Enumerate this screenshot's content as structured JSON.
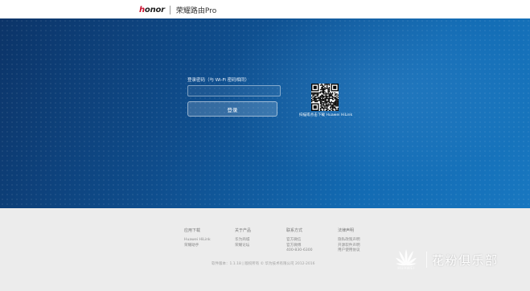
{
  "header": {
    "brand_logo": "honor",
    "product_title": "荣耀路由Pro"
  },
  "login": {
    "password_label": "登录密码（与 Wi-Fi 密码相同）",
    "password_value": "",
    "login_button": "登录"
  },
  "qr": {
    "caption": "扫描或点击下载 Huawei HiLink"
  },
  "footer": {
    "columns": [
      {
        "heading": "应用下载",
        "links": [
          "Huawei HiLink",
          "荣耀助手"
        ]
      },
      {
        "heading": "关于产品",
        "links": [
          "华为商城",
          "荣耀论坛"
        ]
      },
      {
        "heading": "联系方式",
        "links": [
          "官方微信",
          "官方微博",
          "400-830-6300"
        ]
      },
      {
        "heading": "法律声明",
        "links": [
          "隐私政策声明",
          "开源软件声明",
          "用户使用协议"
        ]
      }
    ],
    "copyright": "软件版本：1.1.18 | 版权所有 © 华为技术有限公司 2012-2016"
  },
  "watermark": {
    "brand": "HUAWEI",
    "text": "花粉俱乐部"
  },
  "colors": {
    "hero_dark": "#0c3468",
    "hero_light": "#1877c0",
    "footer_bg": "#ececec",
    "accent_red": "#c8102e"
  }
}
